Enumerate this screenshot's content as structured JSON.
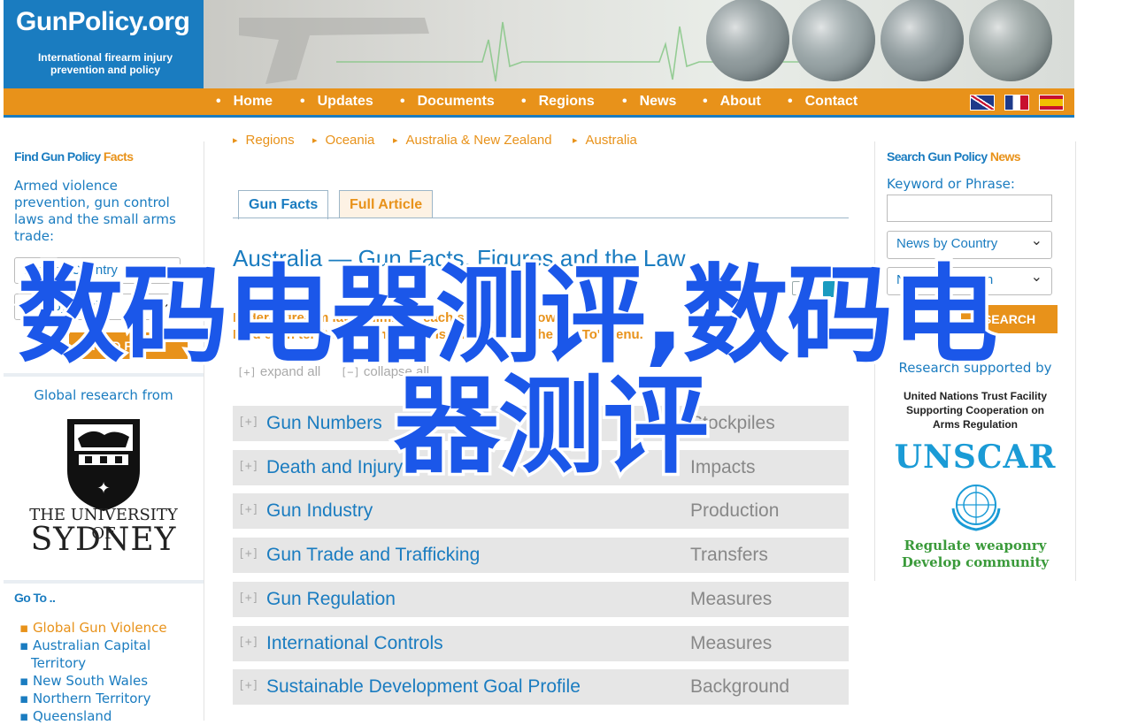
{
  "logo": {
    "name": "GunPolicy.org",
    "tagline": "International firearm injury prevention and policy"
  },
  "nav": {
    "items": [
      "Home",
      "Updates",
      "Documents",
      "Regions",
      "News",
      "About",
      "Contact"
    ]
  },
  "left": {
    "facts_title_a": "Find Gun Policy ",
    "facts_title_b": "Facts",
    "facts_desc": "Armed violence prevention, gun control laws and the small arms trade:",
    "select_country": "Find by Country",
    "select_region": "Find by Region",
    "find_button": "FIND FACTS",
    "research_label": "Global research from",
    "uni_line1": "THE UNIVERSITY OF",
    "uni_line2": "SYDNEY",
    "goto_title": "Go To ..",
    "goto_links": [
      "Global Gun Violence",
      "Australian Capital Territory",
      "New South Wales",
      "Northern Territory",
      "Queensland"
    ]
  },
  "crumbs": [
    "Regions",
    "Oceania",
    "Australia & New Zealand",
    "Australia"
  ],
  "tabs": {
    "gun_facts": "Gun Facts",
    "full_article": "Full Article"
  },
  "main": {
    "title": "Australia — Gun Facts, Figures and the Law",
    "notice_line1": "Federal firearm law is limited: each state has its own gun law.",
    "notice_line2": "Find each territory's comparisons choose from the 'Go To' menu.",
    "expand_all": "expand all",
    "collapse_all": "collapse all",
    "plus_sign": "[+]",
    "minus_sign": "[−]"
  },
  "rows": [
    {
      "name": "Gun Numbers",
      "sub": "Stockpiles"
    },
    {
      "name": "Death and Injury",
      "sub": "Impacts"
    },
    {
      "name": "Gun Industry",
      "sub": "Production"
    },
    {
      "name": "Gun Trade and Trafficking",
      "sub": "Transfers"
    },
    {
      "name": "Gun Regulation",
      "sub": "Measures"
    },
    {
      "name": "International Controls",
      "sub": "Measures"
    },
    {
      "name": "Sustainable Development Goal Profile",
      "sub": "Background"
    }
  ],
  "right": {
    "title_a": "Search Gun Policy ",
    "title_b": "News",
    "keyword_label": "Keyword or Phrase:",
    "keyword_value": "",
    "select_country": "News by Country",
    "select_region": "News by Region",
    "search_button": "SEARCH",
    "research_by": "Research supported by",
    "un_line1": "United Nations Trust Facility",
    "un_line2": "Supporting Cooperation on",
    "un_line3": "Arms Regulation",
    "unscar": "UNSCAR",
    "slogan1": "Regulate weaponry",
    "slogan2": "Develop community"
  },
  "watermark": {
    "line1": "数码电器测评,数码电",
    "line2": "器测评"
  },
  "colors": {
    "blue": "#1a7cc0",
    "orange": "#e8921a",
    "watermark": "#1b57e9"
  },
  "icons": [
    "print-icon",
    "email-icon",
    "chevron-down-icon",
    "un-emblem-icon",
    "sydney-crest-icon",
    "globe-icon"
  ]
}
